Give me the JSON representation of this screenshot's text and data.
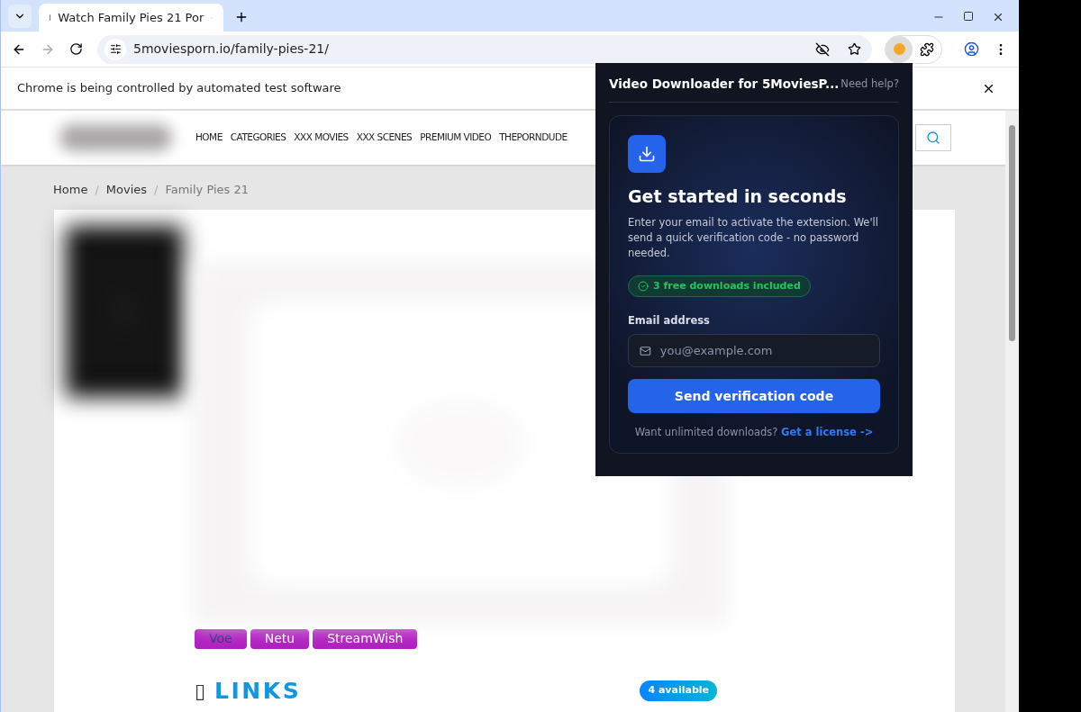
{
  "browser": {
    "tab": {
      "title": "Watch Family Pies 21 Por",
      "selected": true
    },
    "address": "5moviesporn.io/family-pies-21/",
    "infobar": "Chrome is being controlled by automated test software"
  },
  "site": {
    "nav": [
      "HOME",
      "CATEGORIES",
      "XXX MOVIES",
      "XXX SCENES",
      "PREMIUM VIDEO",
      "THEPORNDUDE"
    ],
    "breadcrumb": [
      {
        "label": "Home",
        "current": false
      },
      {
        "label": "Movies",
        "current": false
      },
      {
        "label": "Family Pies 21",
        "current": true
      }
    ],
    "breadcrumb_separator": "/",
    "servers": [
      {
        "label": "Voe",
        "selected": true
      },
      {
        "label": "Netu",
        "selected": false
      },
      {
        "label": "StreamWish",
        "selected": false
      }
    ],
    "links": {
      "icon": "▯",
      "title": "LINKS",
      "badge": "4 available"
    }
  },
  "popup": {
    "title": "Video Downloader for 5MoviesP...",
    "help": "Need help?",
    "heading": "Get started in seconds",
    "description": "Enter your email to activate the extension. We'll send a quick verification code - no password needed.",
    "pill": "3 free downloads included",
    "email_label": "Email address",
    "email_placeholder": "you@example.com",
    "button": "Send verification code",
    "footer": "Want unlimited downloads?",
    "footer_link": "Get a license ->"
  }
}
